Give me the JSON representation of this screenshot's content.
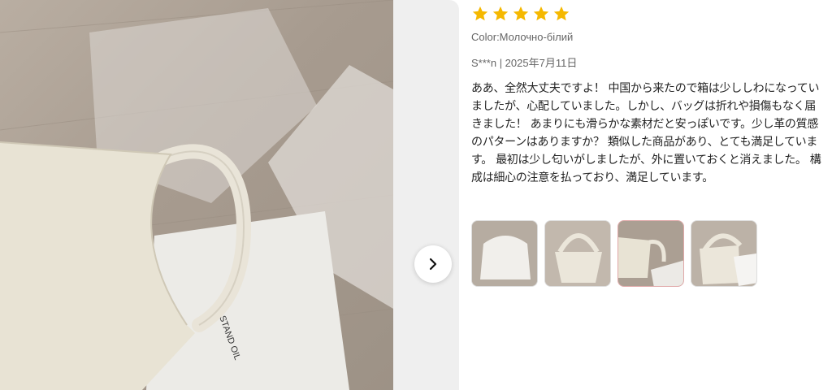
{
  "review": {
    "rating": 5,
    "color_line": "Color:Молочно-білий",
    "reviewer_date": "S***n | 2025年7月11日",
    "text": "ああ、全然大丈夫ですよ！ 中国から来たので箱は少ししわになっていましたが、心配していました。しかし、バッグは折れや損傷もなく届きました！ あまりにも滑らかな素材だと安っぽいです。少し革の質感のパターンはありますか？ 類似した商品があり、とても満足しています。 最初は少し匂いがしましたが、外に置いておくと消えました。 構成は細心の注意を払っており、満足しています。"
  },
  "photo": {
    "bag_label": "STAND OIL"
  },
  "thumbnails": [
    {
      "name": "thumb-1",
      "active": false
    },
    {
      "name": "thumb-2",
      "active": false
    },
    {
      "name": "thumb-3",
      "active": true
    },
    {
      "name": "thumb-4",
      "active": false
    }
  ],
  "colors": {
    "star": "#f5b800",
    "active_thumb_border": "#e0a9a9",
    "panel_bg": "#efefef"
  },
  "icons": {
    "next": "chevron-right-icon",
    "star": "star-icon"
  }
}
